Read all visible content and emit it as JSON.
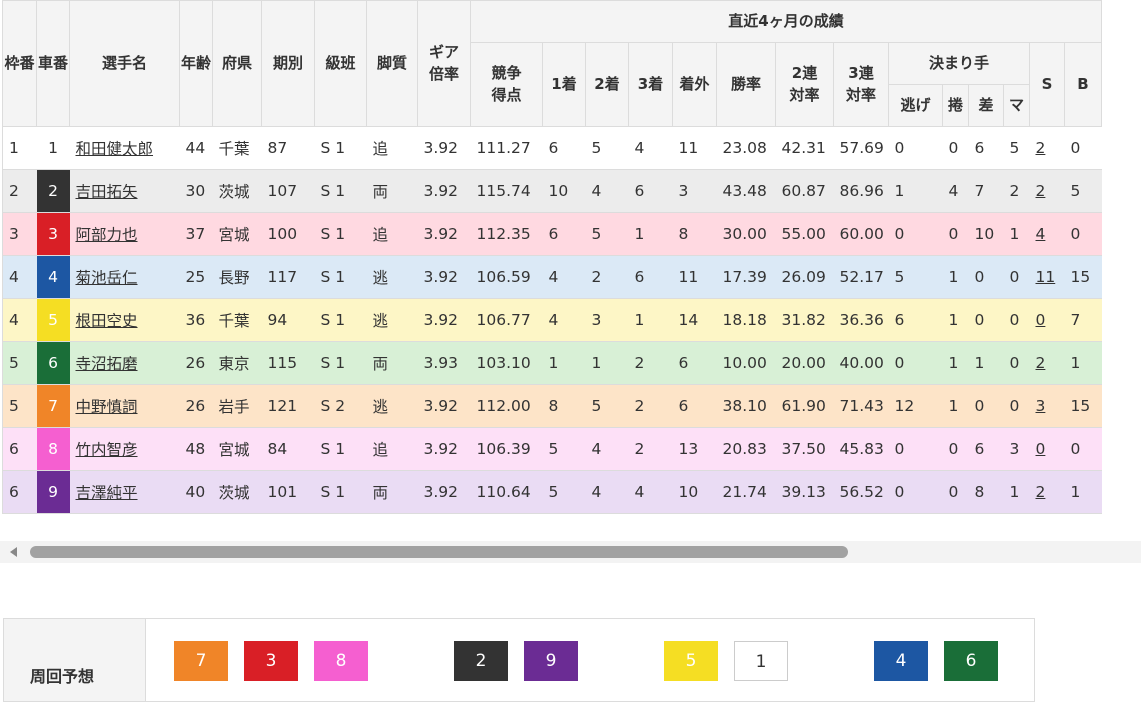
{
  "table": {
    "header": {
      "waku": "枠番",
      "sha": "車番",
      "name": "選手名",
      "age": "年齢",
      "pref": "府県",
      "term": "期別",
      "class": "級班",
      "leg": "脚質",
      "gear": "ギア倍率",
      "group": "直近4ヶ月の成績",
      "score": "競争得点",
      "first": "1着",
      "second": "2着",
      "third": "3着",
      "outside": "着外",
      "win_rate": "勝率",
      "rate2": "2連対率",
      "rate3": "3連対率",
      "kimarite": "決まり手",
      "nige": "逃げ",
      "makuri": "捲",
      "sashi": "差",
      "mark": "マ",
      "s": "S",
      "b": "B"
    },
    "rows": [
      {
        "waku": "1",
        "car": "1",
        "name": "和田健太郎",
        "age": "44",
        "pref": "千葉",
        "term": "87",
        "class": "S 1",
        "leg": "追",
        "gear": "3.92",
        "score": "111.27",
        "first": "6",
        "second": "5",
        "third": "4",
        "outside": "11",
        "win": "23.08",
        "r2": "42.31",
        "r3": "57.69",
        "nige": "0",
        "makuri": "0",
        "sashi": "6",
        "mark": "5",
        "s": "2",
        "b": "0",
        "bg": "#ffffff",
        "car_bg": "#ffffff",
        "car_fg": "#333333"
      },
      {
        "waku": "2",
        "car": "2",
        "name": "吉田拓矢",
        "age": "30",
        "pref": "茨城",
        "term": "107",
        "class": "S 1",
        "leg": "両",
        "gear": "3.92",
        "score": "115.74",
        "first": "10",
        "second": "4",
        "third": "6",
        "outside": "3",
        "win": "43.48",
        "r2": "60.87",
        "r3": "86.96",
        "nige": "1",
        "makuri": "4",
        "sashi": "7",
        "mark": "2",
        "s": "2",
        "b": "5",
        "bg": "#ececec",
        "car_bg": "#333333",
        "car_fg": "#ffffff"
      },
      {
        "waku": "3",
        "car": "3",
        "name": "阿部力也",
        "age": "37",
        "pref": "宮城",
        "term": "100",
        "class": "S 1",
        "leg": "追",
        "gear": "3.92",
        "score": "112.35",
        "first": "6",
        "second": "5",
        "third": "1",
        "outside": "8",
        "win": "30.00",
        "r2": "55.00",
        "r3": "60.00",
        "nige": "0",
        "makuri": "0",
        "sashi": "10",
        "mark": "1",
        "s": "4",
        "b": "0",
        "bg": "#ffd9e1",
        "car_bg": "#d91f26",
        "car_fg": "#ffffff"
      },
      {
        "waku": "4",
        "car": "4",
        "name": "菊池岳仁",
        "age": "25",
        "pref": "長野",
        "term": "117",
        "class": "S 1",
        "leg": "逃",
        "gear": "3.92",
        "score": "106.59",
        "first": "4",
        "second": "2",
        "third": "6",
        "outside": "11",
        "win": "17.39",
        "r2": "26.09",
        "r3": "52.17",
        "nige": "5",
        "makuri": "1",
        "sashi": "0",
        "mark": "0",
        "s": "11",
        "b": "15",
        "bg": "#dbe9f6",
        "car_bg": "#1d57a3",
        "car_fg": "#ffffff"
      },
      {
        "waku": "4",
        "car": "5",
        "name": "根田空史",
        "age": "36",
        "pref": "千葉",
        "term": "94",
        "class": "S 1",
        "leg": "逃",
        "gear": "3.92",
        "score": "106.77",
        "first": "4",
        "second": "3",
        "third": "1",
        "outside": "14",
        "win": "18.18",
        "r2": "31.82",
        "r3": "36.36",
        "nige": "6",
        "makuri": "1",
        "sashi": "0",
        "mark": "0",
        "s": "0",
        "b": "7",
        "bg": "#fdf6c6",
        "car_bg": "#f5de23",
        "car_fg": "#ffffff"
      },
      {
        "waku": "5",
        "car": "6",
        "name": "寺沼拓磨",
        "age": "26",
        "pref": "東京",
        "term": "115",
        "class": "S 1",
        "leg": "両",
        "gear": "3.93",
        "score": "103.10",
        "first": "1",
        "second": "1",
        "third": "2",
        "outside": "6",
        "win": "10.00",
        "r2": "20.00",
        "r3": "40.00",
        "nige": "0",
        "makuri": "1",
        "sashi": "1",
        "mark": "0",
        "s": "2",
        "b": "1",
        "bg": "#d8f0d6",
        "car_bg": "#1a6e38",
        "car_fg": "#ffffff"
      },
      {
        "waku": "5",
        "car": "7",
        "name": "中野慎詞",
        "age": "26",
        "pref": "岩手",
        "term": "121",
        "class": "S 2",
        "leg": "逃",
        "gear": "3.92",
        "score": "112.00",
        "first": "8",
        "second": "5",
        "third": "2",
        "outside": "6",
        "win": "38.10",
        "r2": "61.90",
        "r3": "71.43",
        "nige": "12",
        "makuri": "1",
        "sashi": "0",
        "mark": "0",
        "s": "3",
        "b": "15",
        "bg": "#fde4c8",
        "car_bg": "#f08528",
        "car_fg": "#ffffff"
      },
      {
        "waku": "6",
        "car": "8",
        "name": "竹内智彦",
        "age": "48",
        "pref": "宮城",
        "term": "84",
        "class": "S 1",
        "leg": "追",
        "gear": "3.92",
        "score": "106.39",
        "first": "5",
        "second": "4",
        "third": "2",
        "outside": "13",
        "win": "20.83",
        "r2": "37.50",
        "r3": "45.83",
        "nige": "0",
        "makuri": "0",
        "sashi": "6",
        "mark": "3",
        "s": "0",
        "b": "0",
        "bg": "#fde0f7",
        "car_bg": "#f55fd0",
        "car_fg": "#ffffff"
      },
      {
        "waku": "6",
        "car": "9",
        "name": "吉澤純平",
        "age": "40",
        "pref": "茨城",
        "term": "101",
        "class": "S 1",
        "leg": "両",
        "gear": "3.92",
        "score": "110.64",
        "first": "5",
        "second": "4",
        "third": "4",
        "outside": "10",
        "win": "21.74",
        "r2": "39.13",
        "r3": "56.52",
        "nige": "0",
        "makuri": "0",
        "sashi": "8",
        "mark": "1",
        "s": "2",
        "b": "1",
        "bg": "#eadcf4",
        "car_bg": "#6b2c94",
        "car_fg": "#ffffff"
      }
    ]
  },
  "forecast": {
    "label": "周回予想",
    "boxes": [
      {
        "num": "7",
        "bg": "#f08528",
        "fg": "#ffffff"
      },
      {
        "num": "3",
        "bg": "#d91f26",
        "fg": "#ffffff"
      },
      {
        "num": "8",
        "bg": "#f55fd0",
        "fg": "#ffffff"
      },
      {
        "num": "2",
        "bg": "#333333",
        "fg": "#ffffff"
      },
      {
        "num": "9",
        "bg": "#6b2c94",
        "fg": "#ffffff"
      },
      {
        "num": "5",
        "bg": "#f5de23",
        "fg": "#ffffff"
      },
      {
        "num": "1",
        "bg": "#ffffff",
        "fg": "#333333"
      },
      {
        "num": "4",
        "bg": "#1d57a3",
        "fg": "#ffffff"
      },
      {
        "num": "6",
        "bg": "#1a6e38",
        "fg": "#ffffff"
      }
    ]
  },
  "colors": {
    "header_bg": "#f4f4f4",
    "border": "#dcdcdc",
    "scroll_thumb": "#a2a2a2"
  }
}
